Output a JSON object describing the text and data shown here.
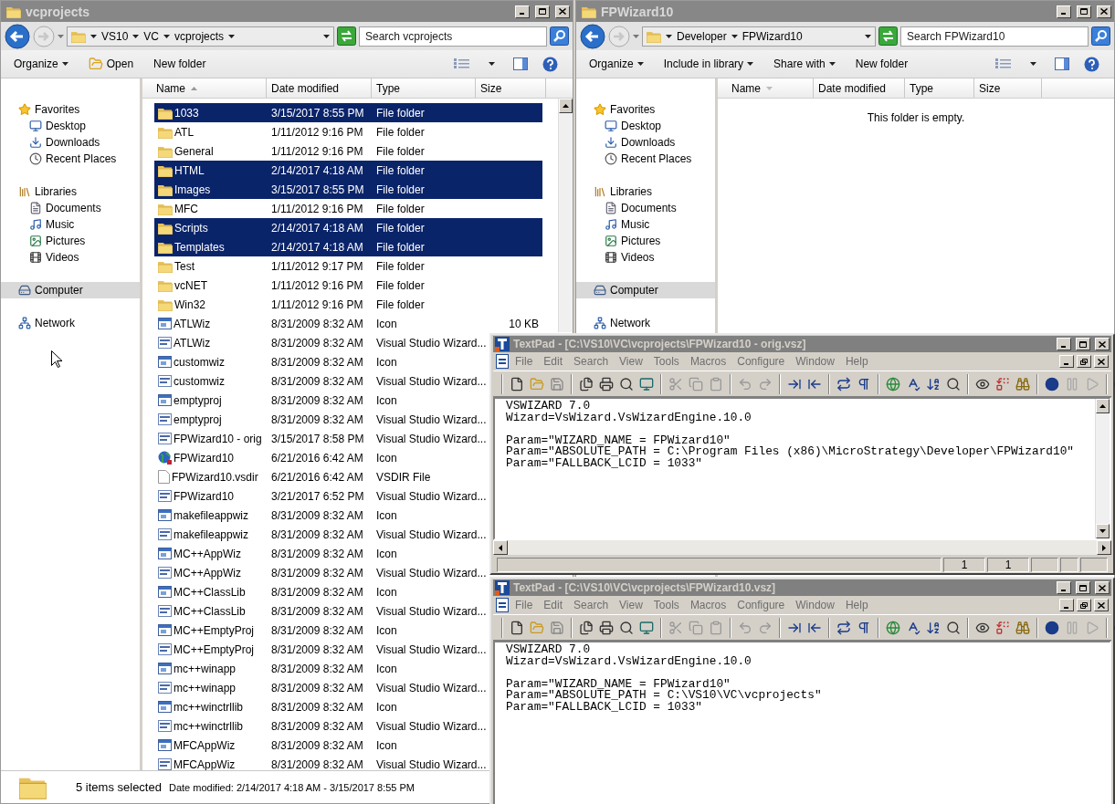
{
  "explorers": [
    {
      "title": "vcprojects",
      "crumbs": [
        "VS10",
        "VC",
        "vcprojects"
      ],
      "search": {
        "placeholder": "Search vcprojects"
      },
      "commands": [
        {
          "label": "Organize",
          "kind": "menu"
        },
        {
          "label": "Open",
          "kind": "open"
        },
        {
          "label": "New folder",
          "kind": "plain"
        }
      ],
      "nav": [
        {
          "label": "Favorites",
          "selected": false,
          "children": [
            {
              "label": "Desktop",
              "selected": false
            },
            {
              "label": "Downloads",
              "selected": false
            },
            {
              "label": "Recent Places",
              "selected": false
            }
          ]
        },
        {
          "label": "Libraries",
          "selected": false,
          "children": [
            {
              "label": "Documents",
              "selected": false
            },
            {
              "label": "Music",
              "selected": false
            },
            {
              "label": "Pictures",
              "selected": false
            },
            {
              "label": "Videos",
              "selected": false
            }
          ]
        },
        {
          "label": "Computer",
          "selected": true
        },
        {
          "label": "Network",
          "selected": false
        }
      ],
      "columns": [
        {
          "label": "Name",
          "sorted": true
        },
        {
          "label": "Date modified"
        },
        {
          "label": "Type"
        },
        {
          "label": "Size"
        }
      ],
      "files": [
        {
          "name": "1033",
          "date": "3/15/2017 8:55 PM",
          "type": "File folder",
          "kind": "folder",
          "selected": true
        },
        {
          "name": "ATL",
          "date": "1/11/2012 9:16 PM",
          "type": "File folder",
          "kind": "folder",
          "selected": false
        },
        {
          "name": "General",
          "date": "1/11/2012 9:16 PM",
          "type": "File folder",
          "kind": "folder",
          "selected": false
        },
        {
          "name": "HTML",
          "date": "2/14/2017 4:18 AM",
          "type": "File folder",
          "kind": "folder",
          "selected": true
        },
        {
          "name": "Images",
          "date": "3/15/2017 8:55 PM",
          "type": "File folder",
          "kind": "folder",
          "selected": true
        },
        {
          "name": "MFC",
          "date": "1/11/2012 9:16 PM",
          "type": "File folder",
          "kind": "folder",
          "selected": false
        },
        {
          "name": "Scripts",
          "date": "2/14/2017 4:18 AM",
          "type": "File folder",
          "kind": "folder",
          "selected": true
        },
        {
          "name": "Templates",
          "date": "2/14/2017 4:18 AM",
          "type": "File folder",
          "kind": "folder",
          "selected": true
        },
        {
          "name": "Test",
          "date": "1/11/2012 9:17 PM",
          "type": "File folder",
          "kind": "folder",
          "selected": false
        },
        {
          "name": "vcNET",
          "date": "1/11/2012 9:16 PM",
          "type": "File folder",
          "kind": "folder",
          "selected": false
        },
        {
          "name": "Win32",
          "date": "1/11/2012 9:16 PM",
          "type": "File folder",
          "kind": "folder",
          "selected": false
        },
        {
          "name": "ATLWiz",
          "date": "8/31/2009 8:32 AM",
          "type": "Icon",
          "size": "10 KB",
          "kind": "image",
          "selected": false
        },
        {
          "name": "ATLWiz",
          "date": "8/31/2009 8:32 AM",
          "type": "Visual Studio Wizard...",
          "kind": "wizard",
          "selected": false
        },
        {
          "name": "customwiz",
          "date": "8/31/2009 8:32 AM",
          "type": "Icon",
          "kind": "image",
          "selected": false
        },
        {
          "name": "customwiz",
          "date": "8/31/2009 8:32 AM",
          "type": "Visual Studio Wizard...",
          "kind": "wizard",
          "selected": false
        },
        {
          "name": "emptyproj",
          "date": "8/31/2009 8:32 AM",
          "type": "Icon",
          "kind": "image",
          "selected": false
        },
        {
          "name": "emptyproj",
          "date": "8/31/2009 8:32 AM",
          "type": "Visual Studio Wizard...",
          "kind": "wizard",
          "selected": false
        },
        {
          "name": "FPWizard10 - orig",
          "date": "3/15/2017 8:58 PM",
          "type": "Visual Studio Wizard...",
          "kind": "wizard",
          "selected": false
        },
        {
          "name": "FPWizard10",
          "date": "6/21/2016 6:42 AM",
          "type": "Icon",
          "kind": "globe",
          "selected": false
        },
        {
          "name": "FPWizard10.vsdir",
          "date": "6/21/2016 6:42 AM",
          "type": "VSDIR File",
          "kind": "plain",
          "selected": false
        },
        {
          "name": "FPWizard10",
          "date": "3/21/2017 6:52 PM",
          "type": "Visual Studio Wizard...",
          "kind": "wizard",
          "selected": false
        },
        {
          "name": "makefileappwiz",
          "date": "8/31/2009 8:32 AM",
          "type": "Icon",
          "kind": "image",
          "selected": false
        },
        {
          "name": "makefileappwiz",
          "date": "8/31/2009 8:32 AM",
          "type": "Visual Studio Wizard...",
          "kind": "wizard",
          "selected": false
        },
        {
          "name": "MC++AppWiz",
          "date": "8/31/2009 8:32 AM",
          "type": "Icon",
          "kind": "image",
          "selected": false
        },
        {
          "name": "MC++AppWiz",
          "date": "8/31/2009 8:32 AM",
          "type": "Visual Studio Wizard...",
          "kind": "wizard",
          "selected": false
        },
        {
          "name": "MC++ClassLib",
          "date": "8/31/2009 8:32 AM",
          "type": "Icon",
          "kind": "image",
          "selected": false
        },
        {
          "name": "MC++ClassLib",
          "date": "8/31/2009 8:32 AM",
          "type": "Visual Studio Wizard...",
          "kind": "wizard",
          "selected": false
        },
        {
          "name": "MC++EmptyProj",
          "date": "8/31/2009 8:32 AM",
          "type": "Icon",
          "kind": "image",
          "selected": false
        },
        {
          "name": "MC++EmptyProj",
          "date": "8/31/2009 8:32 AM",
          "type": "Visual Studio Wizard...",
          "kind": "wizard",
          "selected": false
        },
        {
          "name": "mc++winapp",
          "date": "8/31/2009 8:32 AM",
          "type": "Icon",
          "kind": "image",
          "selected": false
        },
        {
          "name": "mc++winapp",
          "date": "8/31/2009 8:32 AM",
          "type": "Visual Studio Wizard...",
          "kind": "wizard",
          "selected": false
        },
        {
          "name": "mc++winctrllib",
          "date": "8/31/2009 8:32 AM",
          "type": "Icon",
          "kind": "image",
          "selected": false
        },
        {
          "name": "mc++winctrllib",
          "date": "8/31/2009 8:32 AM",
          "type": "Visual Studio Wizard...",
          "kind": "wizard",
          "selected": false
        },
        {
          "name": "MFCAppWiz",
          "date": "8/31/2009 8:32 AM",
          "type": "Icon",
          "kind": "image",
          "selected": false
        },
        {
          "name": "MFCAppWiz",
          "date": "8/31/2009 8:32 AM",
          "type": "Visual Studio Wizard...",
          "kind": "wizard",
          "selected": false
        }
      ],
      "status": {
        "count": "5 items selected",
        "detail": "Date modified: 2/14/2017 4:18 AM - 3/15/2017 8:55 PM"
      }
    },
    {
      "title": "FPWizard10",
      "crumbs": [
        "Developer",
        "FPWizard10"
      ],
      "search": {
        "placeholder": "Search FPWizard10"
      },
      "commands": [
        {
          "label": "Organize",
          "kind": "menu"
        },
        {
          "label": "Include in library",
          "kind": "menu"
        },
        {
          "label": "Share with",
          "kind": "menu"
        },
        {
          "label": "New folder",
          "kind": "plain"
        }
      ],
      "nav": [
        {
          "label": "Favorites",
          "selected": false,
          "children": [
            {
              "label": "Desktop",
              "selected": false
            },
            {
              "label": "Downloads",
              "selected": false
            },
            {
              "label": "Recent Places",
              "selected": false
            }
          ]
        },
        {
          "label": "Libraries",
          "selected": false,
          "children": [
            {
              "label": "Documents",
              "selected": false
            },
            {
              "label": "Music",
              "selected": false
            },
            {
              "label": "Pictures",
              "selected": false
            },
            {
              "label": "Videos",
              "selected": false
            }
          ]
        },
        {
          "label": "Computer",
          "selected": true
        },
        {
          "label": "Network",
          "selected": false
        }
      ],
      "columns": [
        {
          "label": "Name",
          "dropdown": true
        },
        {
          "label": "Date modified"
        },
        {
          "label": "Type"
        },
        {
          "label": "Size"
        }
      ],
      "empty_text": "This folder is empty."
    }
  ],
  "editors": [
    {
      "title": "TextPad - [C:\\VS10\\VC\\vcprojects\\FPWizard10 - orig.vsz]",
      "menu": [
        "File",
        "Edit",
        "Search",
        "View",
        "Tools",
        "Macros",
        "Configure",
        "Window",
        "Help"
      ],
      "blocks": [
        [
          "VSWIZARD 7.0",
          "Wizard=VsWizard.VsWizardEngine.10.0"
        ],
        [
          "Param=\"WIZARD_NAME = FPWizard10\"",
          "Param=\"ABSOLUTE_PATH = C:\\Program Files (x86)\\MicroStrategy\\Developer\\FPWizard10\"",
          "Param=\"FALLBACK_LCID = 1033\""
        ]
      ],
      "status": [
        "1",
        "1"
      ]
    },
    {
      "title": "TextPad - [C:\\VS10\\VC\\vcprojects\\FPWizard10.vsz]",
      "menu": [
        "File",
        "Edit",
        "Search",
        "View",
        "Tools",
        "Macros",
        "Configure",
        "Window",
        "Help"
      ],
      "blocks": [
        [
          "VSWIZARD 7.0",
          "Wizard=VsWizard.VsWizardEngine.10.0"
        ],
        [
          "Param=\"WIZARD_NAME = FPWizard10\"",
          "Param=\"ABSOLUTE_PATH = C:\\VS10\\VC\\vcprojects\"",
          "Param=\"FALLBACK_LCID = 1033\""
        ]
      ]
    }
  ]
}
